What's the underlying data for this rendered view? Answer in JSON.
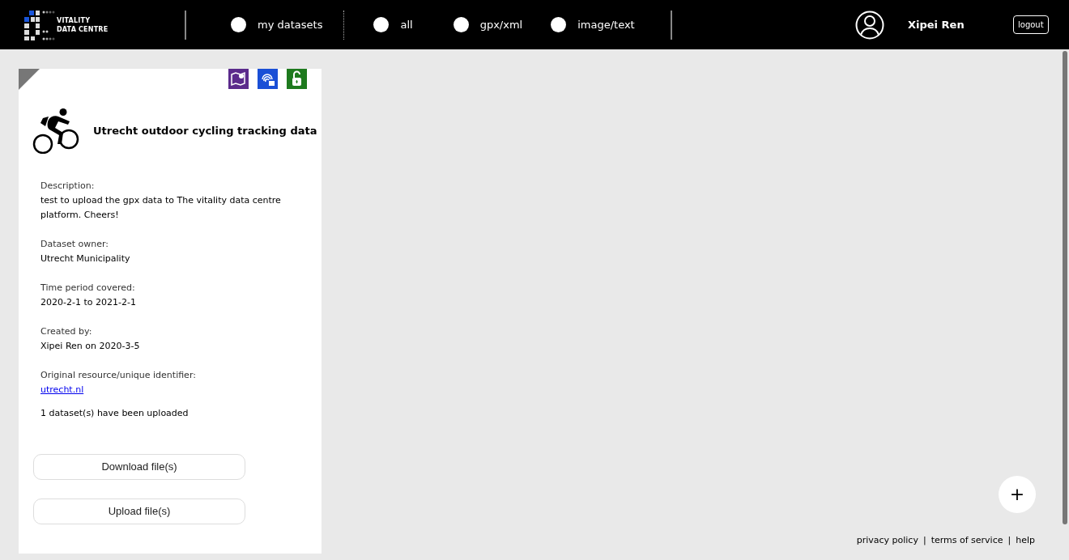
{
  "logo": {
    "line_1": "VITALITY",
    "line_2": "DATA CENTRE"
  },
  "filters": [
    {
      "label": "my datasets",
      "selected": false
    },
    {
      "label": "all",
      "selected": false
    },
    {
      "label": "gpx/xml",
      "selected": false
    },
    {
      "label": "image/text",
      "selected": false
    }
  ],
  "user": {
    "name": "Xipei Ren",
    "logout": "logout"
  },
  "card": {
    "title": "Utrecht outdoor cycling tracking data",
    "fields": [
      {
        "label": "Description:",
        "value": "test to upload the gpx data to The vitality data centre platform. Cheers!",
        "kind": "text"
      },
      {
        "label": "Dataset owner:",
        "value": "Utrecht Municipality",
        "kind": "text"
      },
      {
        "label": "Time period covered:",
        "value": "2020-2-1 to 2021-2-1",
        "kind": "text"
      },
      {
        "label": "Created by:",
        "value": "Xipei Ren on 2020-3-5",
        "kind": "text"
      },
      {
        "label": "Original resource/unique identifier:",
        "value": "utrecht.nl",
        "kind": "link"
      }
    ],
    "upload_count": "1 dataset(s) have been uploaded",
    "buttons": [
      "Download file(s)",
      "Upload file(s)"
    ]
  },
  "add_button": "+",
  "footer": {
    "links": [
      "privacy policy",
      "terms of service",
      "help"
    ],
    "separator": "|"
  }
}
